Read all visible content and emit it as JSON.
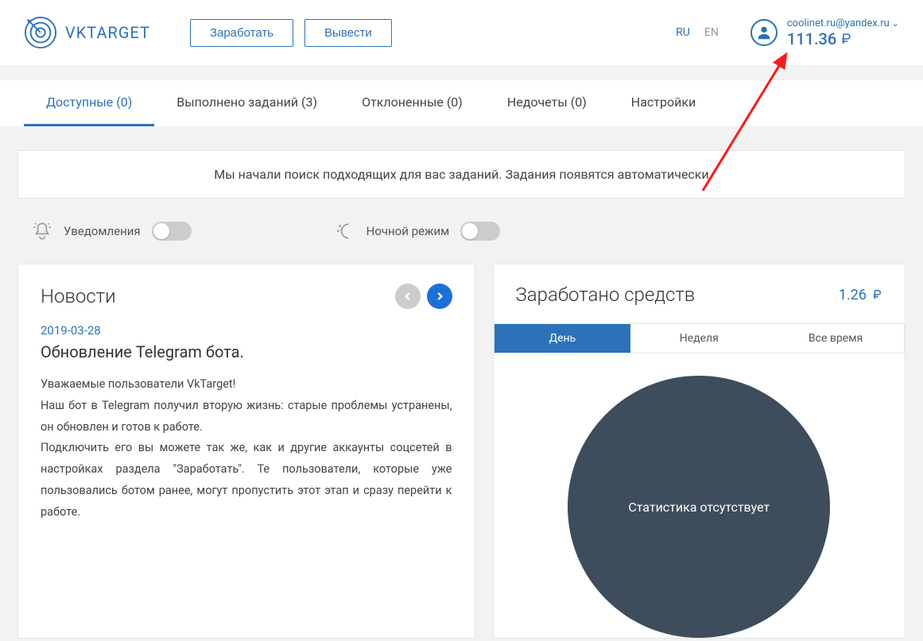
{
  "header": {
    "logo_text": "VKTARGET",
    "btn_earn": "Заработать",
    "btn_withdraw": "Вывести",
    "lang_ru": "RU",
    "lang_en": "EN",
    "user_email": "coolinet.ru@yandex.ru",
    "user_balance": "111.36"
  },
  "tabs": {
    "available": "Доступные (0)",
    "completed": "Выполнено заданий (3)",
    "rejected": "Отклоненные (0)",
    "issues": "Недочеты (0)",
    "settings": "Настройки"
  },
  "notice": "Мы начали поиск подходящих для вас заданий. Задания появятся автоматически",
  "toggles": {
    "notifications": "Уведомления",
    "night_mode": "Ночной режим"
  },
  "news": {
    "title": "Новости",
    "date": "2019-03-28",
    "headline": "Обновление Telegram бота.",
    "body": "Уважаемые пользователи VkTarget!\nНаш бот в Telegram получил вторую жизнь: старые проблемы устранены, он обновлен и готов к работе.\nПодключить его вы можете так же, как и другие аккаунты соцсетей в настройках раздела \"Заработать\". Те пользователи, которые уже пользовались ботом ранее, могут пропустить этот этап и сразу перейти к работе."
  },
  "earnings": {
    "title": "Заработано средств",
    "amount": "1.26",
    "period_day": "День",
    "period_week": "Неделя",
    "period_all": "Все время",
    "no_stats": "Статистика отсутствует"
  }
}
